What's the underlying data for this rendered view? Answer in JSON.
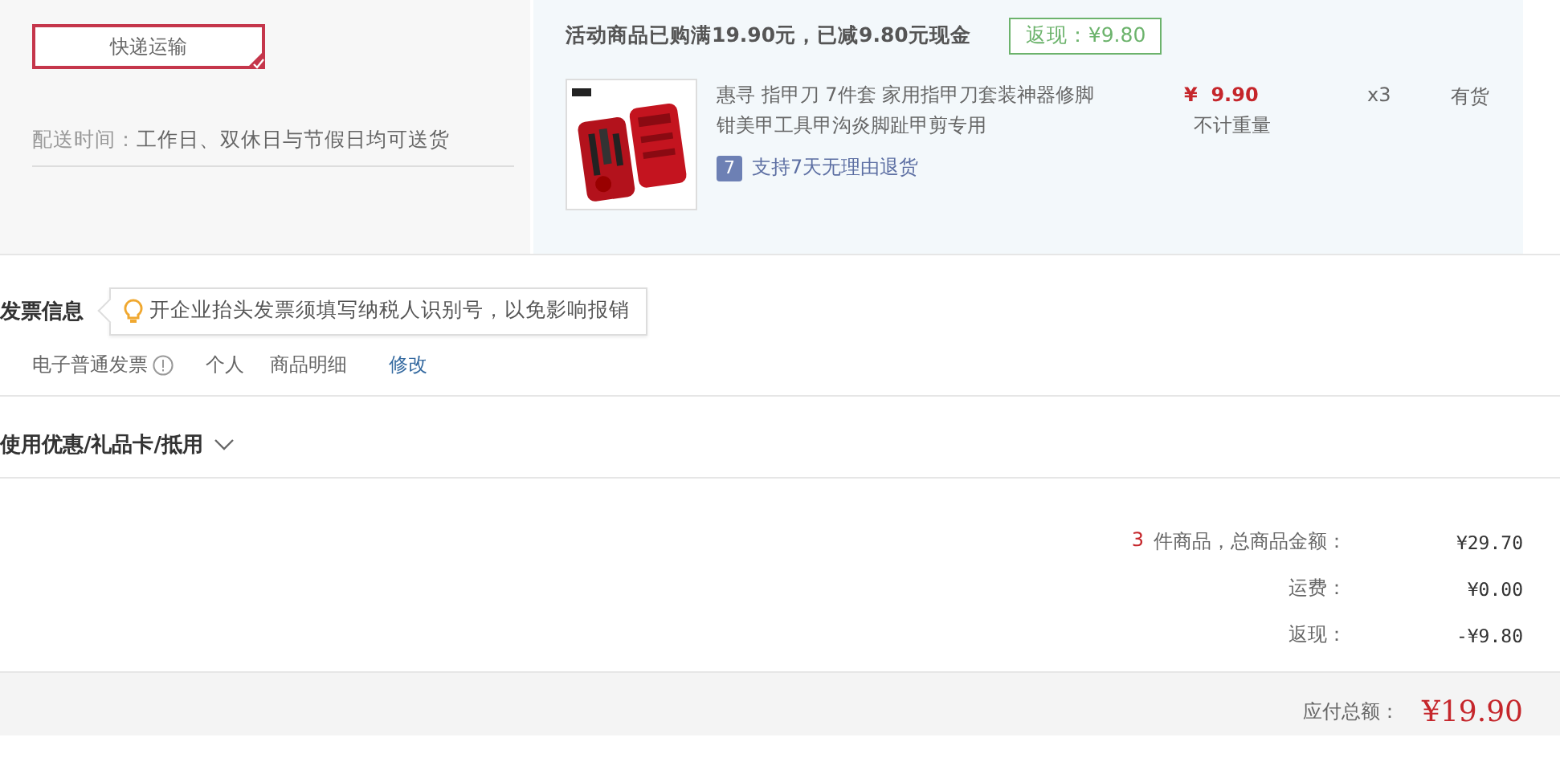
{
  "delivery": {
    "options": [
      {
        "label": "快递运输",
        "selected": true
      }
    ],
    "time_label": "配送时间：",
    "time_value": "工作日、双休日与节假日均可送货"
  },
  "goods": {
    "promo": "活动商品已购满19.90元，已减9.80元现金",
    "cashback_badge": "返现：¥9.80",
    "items": [
      {
        "title": "惠寻 指甲刀 7件套 家用指甲刀套装神器修脚钳美甲工具甲沟炎脚趾甲剪专用",
        "service_badge": "7",
        "service": "支持7天无理由退货",
        "price": "¥  9.90",
        "weight": "不计重量",
        "quantity": "x3",
        "stock": "有货"
      }
    ]
  },
  "invoice": {
    "title": "发票信息",
    "tip": "开企业抬头发票须填写纳税人识别号，以免影响报销",
    "type": "电子普通发票",
    "header": "个人",
    "content": "商品明细",
    "edit_link": "修改"
  },
  "coupons": {
    "title": "使用优惠/礼品卡/抵用",
    "expanded": false
  },
  "summary": {
    "rows": [
      {
        "count": "3",
        "label": "件商品，总商品金额：",
        "value": "¥29.70"
      },
      {
        "label": "运费：",
        "value": "¥0.00"
      },
      {
        "label": "返现：",
        "value": "-¥9.80"
      }
    ],
    "total_label": "应付总额：",
    "total": "¥19.90"
  }
}
